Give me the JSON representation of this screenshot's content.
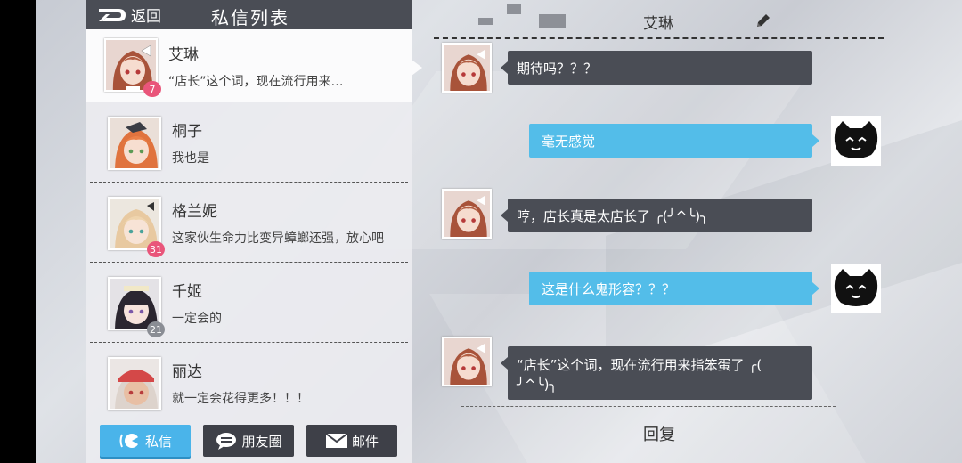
{
  "left_panel": {
    "back_label": "返回",
    "title": "私信列表"
  },
  "contacts": [
    {
      "name": "艾琳",
      "preview": "“店长”这个词，现在流行用来…",
      "badge": "7",
      "badge_color": "#e9557a"
    },
    {
      "name": "桐子",
      "preview": "我也是"
    },
    {
      "name": "格兰妮",
      "preview": "这家伙生命力比变异蟑螂还强，放心吧",
      "badge": "31",
      "badge_color": "#e9557a"
    },
    {
      "name": "千姬",
      "preview": "一定会的",
      "badge": "21",
      "badge_color": "#8a8d94"
    },
    {
      "name": "丽达",
      "preview": "就一定会花得更多！！！"
    }
  ],
  "tabs": [
    {
      "label": "私信",
      "icon": "chat-face-icon",
      "active": true
    },
    {
      "label": "朋友圈",
      "icon": "speech-bubble-icon",
      "active": false
    },
    {
      "label": "邮件",
      "icon": "envelope-icon",
      "active": false
    }
  ],
  "chat": {
    "title": "艾琳",
    "messages": [
      {
        "from": "other",
        "text": "期待吗？？？"
      },
      {
        "from": "self",
        "text": "毫无感觉"
      },
      {
        "from": "other",
        "text": "哼，店长真是太店长了 ╭(╯^╰)╮"
      },
      {
        "from": "self",
        "text": "这是什么鬼形容？？？"
      },
      {
        "from": "other",
        "text_line1": "“店长”这个词，现在流行用来指笨蛋了 ╭(",
        "text_line2": "╯^╰)╮"
      }
    ],
    "reply_label": "回复"
  },
  "colors": {
    "header_dark": "#4a4d55",
    "accent_blue": "#4ab4ea",
    "bubble_out": "#53bde9",
    "badge_pink": "#e9557a"
  }
}
